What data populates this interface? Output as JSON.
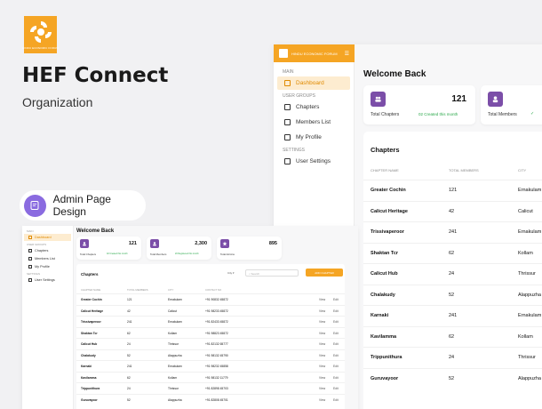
{
  "brand": {
    "logo_text": "HINDU ECONOMIC FORUM",
    "title": "HEF Connect",
    "subtitle": "Organization"
  },
  "pill": {
    "label": "Admin Page Design"
  },
  "colors": {
    "accent": "#f5a524",
    "purple": "#7b4ea8",
    "green": "#2aa84a"
  },
  "big_app": {
    "brand": "HINDU ECONOMIC FORUM",
    "sections": {
      "main": "MAIN",
      "user_groups": "USER GROUPS",
      "settings": "SETTINGS"
    },
    "nav": {
      "dashboard": "Dashboard",
      "chapters": "Chapters",
      "members": "Members List",
      "profile": "My Profile",
      "settings": "User Settings"
    },
    "welcome": "Welcome Back",
    "cards": [
      {
        "label": "Total Chapters",
        "value": "121",
        "sub": "02 Created this month"
      },
      {
        "label": "Total Members",
        "value": "",
        "sub": ""
      }
    ],
    "table": {
      "title": "Chapters",
      "headers": {
        "name": "CHAPTER NAME",
        "members": "TOTAL MEMBERS",
        "city": "CITY"
      },
      "rows": [
        {
          "name": "Greater Cochin",
          "members": "121",
          "city": "Ernakulam"
        },
        {
          "name": "Calicut Heritage",
          "members": "42",
          "city": "Calicut"
        },
        {
          "name": "Trissivaperoor",
          "members": "241",
          "city": "Ernakulam"
        },
        {
          "name": "Shaktan Tcr",
          "members": "62",
          "city": "Kollam"
        },
        {
          "name": "Calicut Hub",
          "members": "24",
          "city": "Thrissur"
        },
        {
          "name": "Chalakudy",
          "members": "52",
          "city": "Alappuzha"
        },
        {
          "name": "Karnaki",
          "members": "241",
          "city": "Ernakulam"
        },
        {
          "name": "Kavilamma",
          "members": "62",
          "city": "Kollam"
        },
        {
          "name": "Trippunithura",
          "members": "24",
          "city": "Thrissur"
        },
        {
          "name": "Guruvayoor",
          "members": "52",
          "city": "Alappuzha"
        }
      ]
    }
  },
  "small_app": {
    "sections": {
      "main": "MAIN",
      "user_groups": "USER GROUPS",
      "settings": "SETTINGS"
    },
    "nav": {
      "dashboard": "Dashboard",
      "chapters": "Chapters",
      "members": "Members List",
      "profile": "My Profile",
      "settings": "User Settings"
    },
    "welcome": "Welcome Back",
    "cards": [
      {
        "label": "Total Chapters",
        "value": "121",
        "sub": "02 Created this month"
      },
      {
        "label": "Total Members",
        "value": "2,300",
        "sub": "20 Registered this month"
      },
      {
        "label": "Total Admins",
        "value": "895",
        "sub": ""
      }
    ],
    "table": {
      "title": "Chapters",
      "city_filter": "City",
      "search_placeholder": "Search",
      "add_button": "ADD CHAPTER",
      "headers": {
        "name": "CHAPTER NAME",
        "members": "TOTAL MEMBERS",
        "city": "CITY",
        "contact": "CONTACT NO"
      },
      "actions": {
        "view": "View",
        "edit": "Edit"
      },
      "rows": [
        {
          "name": "Greater Cochin",
          "members": "121",
          "city": "Ernakulam",
          "contact": "+91 90832 45872"
        },
        {
          "name": "Calicut Heritage",
          "members": "42",
          "city": "Calicut",
          "contact": "+91 98233 45872"
        },
        {
          "name": "Trissivaperoor",
          "members": "241",
          "city": "Ernakulam",
          "contact": "+91 82433 45872"
        },
        {
          "name": "Shaktan Tcr",
          "members": "62",
          "city": "Kollam",
          "contact": "+91 98823 45872"
        },
        {
          "name": "Calicut Hub",
          "members": "24",
          "city": "Thrissur",
          "contact": "+91 82132 65777"
        },
        {
          "name": "Chalakudy",
          "members": "52",
          "city": "Alappuzha",
          "contact": "+91 98132 45790"
        },
        {
          "name": "Karnaki",
          "members": "241",
          "city": "Ernakulam",
          "contact": "+91 98232 45858"
        },
        {
          "name": "Kavilamma",
          "members": "62",
          "city": "Kollam",
          "contact": "+91 98132 11779"
        },
        {
          "name": "Trippunithura",
          "members": "24",
          "city": "Thrissur",
          "contact": "+91 82898 45703"
        },
        {
          "name": "Guruvayoor",
          "members": "52",
          "city": "Alappuzha",
          "contact": "+91 82808 45701"
        }
      ]
    }
  }
}
